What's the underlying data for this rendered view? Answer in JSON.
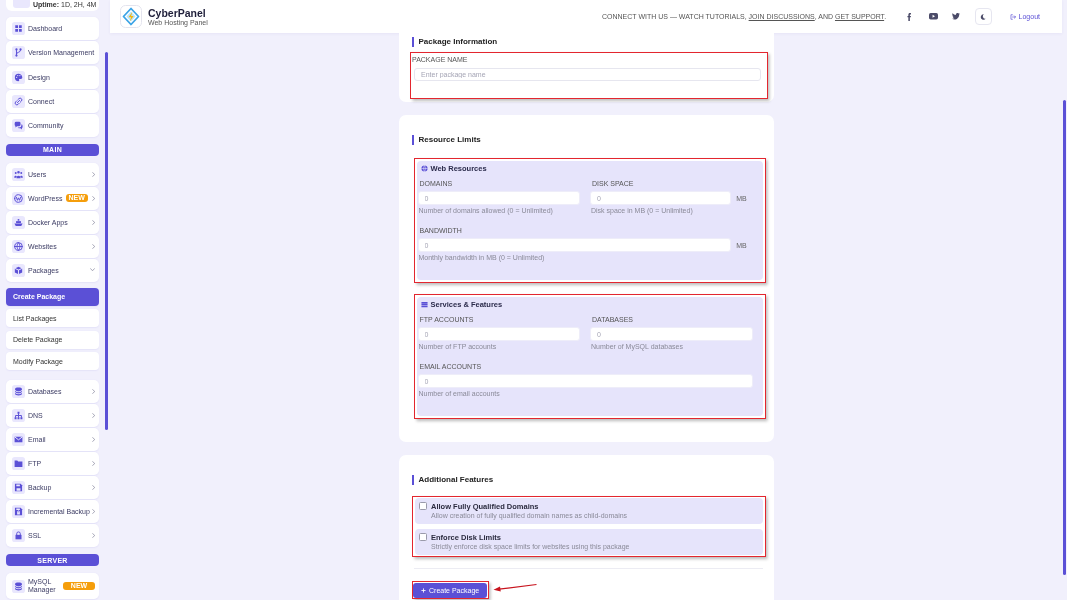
{
  "sidebar": {
    "uptime": "**Uptime:** 1D, 2H, 4M",
    "links": [
      {
        "label": "Dashboard"
      },
      {
        "label": "Version Management"
      },
      {
        "label": "Design"
      },
      {
        "label": "Connect"
      },
      {
        "label": "Community"
      }
    ],
    "sections": [
      {
        "title": "MAIN",
        "items": [
          {
            "kind": "group",
            "label": "Users",
            "expanded": false
          },
          {
            "kind": "group",
            "label": "WordPress",
            "badge": "NEW",
            "expanded": false
          },
          {
            "kind": "group",
            "label": "Docker Apps",
            "expanded": false
          },
          {
            "kind": "group",
            "label": "Websites",
            "expanded": false
          },
          {
            "kind": "group",
            "label": "Packages",
            "expanded": true,
            "children": [
              {
                "label": "Create Package",
                "selected": true
              },
              {
                "label": "List Packages",
                "selected": false
              },
              {
                "label": "Delete Package",
                "selected": false
              },
              {
                "label": "Modify Package",
                "selected": false
              }
            ]
          },
          {
            "kind": "group",
            "label": "Databases",
            "expanded": false
          },
          {
            "kind": "group",
            "label": "DNS",
            "expanded": false
          },
          {
            "kind": "group",
            "label": "Email",
            "expanded": false
          },
          {
            "kind": "group",
            "label": "FTP",
            "expanded": false
          },
          {
            "kind": "group",
            "label": "Backup",
            "expanded": false
          },
          {
            "kind": "group",
            "label": "Incremental Backup",
            "expanded": false
          },
          {
            "kind": "group",
            "label": "SSL",
            "expanded": false
          }
        ]
      },
      {
        "title": "SERVER",
        "items": [
          {
            "kind": "link",
            "label": "MySQL Manager",
            "badge": "NEW"
          }
        ]
      }
    ]
  },
  "header": {
    "brand": "CyberPanel",
    "tagline": "Web Hosting Panel",
    "connect": [
      {
        "kind": "text",
        "text": "CONNECT WITH US — WATCH TUTORIALS, "
      },
      {
        "kind": "link",
        "text": "JOIN DISCUSSIONS"
      },
      {
        "kind": "text",
        "text": ", AND "
      },
      {
        "kind": "link",
        "text": "GET SUPPORT"
      },
      {
        "kind": "text",
        "text": "."
      }
    ],
    "logout": "Logout"
  },
  "package_information": {
    "title": "Package Information",
    "fields_highlighted": true,
    "fields": [
      {
        "label": "PACKAGE NAME",
        "placeholder": "Enter package name"
      }
    ]
  },
  "resource_limits": {
    "title": "Resource Limits",
    "groups": [
      {
        "title": "Web Resources",
        "highlighted": true,
        "fields": [
          {
            "label": "DOMAINS",
            "placeholder": "0",
            "help": "Number of domains allowed (0 = Unlimited)"
          },
          {
            "label": "DISK SPACE",
            "placeholder": "0",
            "unit": "MB",
            "help": "Disk space in MB (0 = Unlimited)"
          },
          {
            "label": "BANDWIDTH",
            "placeholder": "0",
            "unit": "MB",
            "help": "Monthly bandwidth in MB (0 = Unlimited)"
          }
        ]
      },
      {
        "title": "Services & Features",
        "highlighted": true,
        "fields": [
          {
            "label": "FTP ACCOUNTS",
            "placeholder": "0",
            "help": "Number of FTP accounts"
          },
          {
            "label": "DATABASES",
            "placeholder": "0",
            "help": "Number of MySQL databases"
          },
          {
            "label": "EMAIL ACCOUNTS",
            "placeholder": "0",
            "help": "Number of email accounts"
          }
        ]
      }
    ]
  },
  "additional_features": {
    "title": "Additional Features",
    "options_highlighted": true,
    "options": [
      {
        "label": "Allow Fully Qualified Domains",
        "description": "Allow creation of fully qualified domain names as child-domains",
        "checked": false
      },
      {
        "label": "Enforce Disk Limits",
        "description": "Strictly enforce disk space limits for websites using this package",
        "checked": false
      }
    ],
    "submit": {
      "label": "Create Package",
      "highlighted": true
    }
  }
}
